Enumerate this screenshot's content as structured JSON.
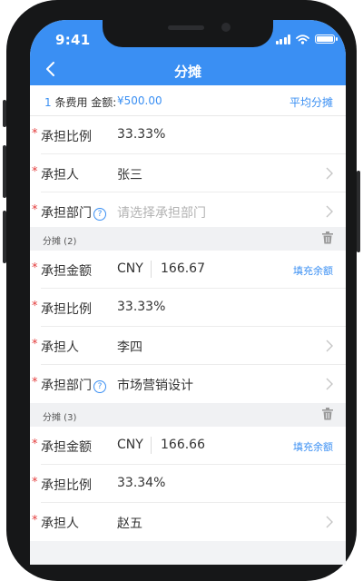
{
  "status_bar": {
    "time": "9:41"
  },
  "nav": {
    "title": "分摊"
  },
  "summary": {
    "count": "1",
    "count_label": " 条费用 金额:",
    "amount": "¥500.00",
    "average_button": "平均分摊"
  },
  "rows_top": [
    {
      "label": "承担比例",
      "value": "33.33%"
    },
    {
      "label": "承担人",
      "value": "张三"
    },
    {
      "label": "承担部门",
      "placeholder": "请选择承担部门"
    }
  ],
  "groups": [
    {
      "title": "分摊 (2)",
      "amount_label": "承担金额",
      "currency": "CNY",
      "amount": "166.67",
      "fill_button": "填充余额",
      "ratio_label": "承担比例",
      "ratio": "33.33%",
      "person_label": "承担人",
      "person": "李四",
      "dept_label": "承担部门",
      "dept": "市场营销设计"
    },
    {
      "title": "分摊 (3)",
      "amount_label": "承担金额",
      "currency": "CNY",
      "amount": "166.66",
      "fill_button": "填充余额",
      "ratio_label": "承担比例",
      "ratio": "33.34%",
      "person_label": "承担人",
      "person": "赵五"
    }
  ],
  "required_mark": "*",
  "help_mark": "?",
  "colors": {
    "accent": "#3a8ff3",
    "required": "#e33b3b",
    "phone_frame": "#161718"
  },
  "icons": [
    "back-icon",
    "chevron-right-icon",
    "help-circle-icon",
    "trash-icon",
    "signal-icon",
    "wifi-icon",
    "battery-icon"
  ]
}
